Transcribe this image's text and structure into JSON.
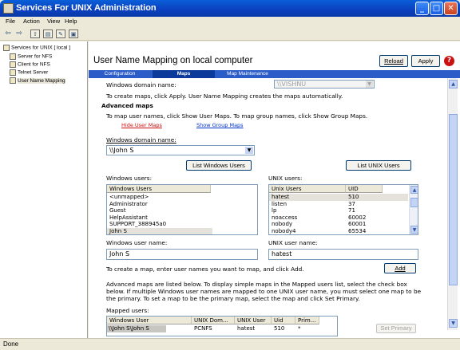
{
  "window": {
    "title": "Services For UNIX Administration"
  },
  "menu": [
    "File",
    "Action",
    "View",
    "Help"
  ],
  "toolbar_icons": [
    "back-arrow-icon",
    "forward-arrow-icon",
    "up-folder-icon",
    "show-tree-icon",
    "properties-icon",
    "help-icon"
  ],
  "tree": {
    "root": "Services for UNIX [ local ]",
    "items": [
      "Server for NFS",
      "Client for NFS",
      "Telnet Server",
      "User Name Mapping"
    ]
  },
  "page": {
    "title": "User Name Mapping on local computer",
    "reload_label": "Reload",
    "apply_label": "Apply",
    "tabs": [
      "Configuration",
      "Maps",
      "Map Maintenance"
    ]
  },
  "maps": {
    "domain_label_top": "Windows domain name:",
    "domain_value_top": "\\\\VISHNU",
    "create_hint": "To create maps, click Apply. User Name Mapping creates the maps automatically.",
    "advanced_heading": "Advanced maps",
    "advanced_hint": "To map user names, click Show User Maps. To map group names, click Show Group Maps.",
    "hide_user_maps": "Hide User Maps",
    "show_group_maps": "Show Group Maps",
    "windows_domain_label": "Windows domain name:",
    "windows_domain_value": "\\\\John S",
    "list_windows_users": "List Windows Users",
    "list_unix_users": "List UNIX Users",
    "windows_users_label": "Windows users:",
    "unix_users_label": "UNIX users:",
    "windows_users_header": "Windows Users",
    "windows_users": [
      "<unmapped>",
      "Administrator",
      "Guest",
      "HelpAssistant",
      "SUPPORT_388945a0",
      "John S"
    ],
    "unix_users_headers": [
      "Unix Users",
      "UID"
    ],
    "unix_users": [
      {
        "name": "hatest",
        "uid": "510"
      },
      {
        "name": "listen",
        "uid": "37"
      },
      {
        "name": "lp",
        "uid": "71"
      },
      {
        "name": "noaccess",
        "uid": "60002"
      },
      {
        "name": "nobody",
        "uid": "60001"
      },
      {
        "name": "nobody4",
        "uid": "65534"
      }
    ],
    "windows_user_name_label": "Windows user name:",
    "windows_user_name_value": "John S",
    "unix_user_name_label": "UNIX user name:",
    "unix_user_name_value": "hatest",
    "add_hint": "To create a map, enter user names you want to map, and click Add.",
    "add_label": "Add",
    "advanced_desc_1": "Advanced maps are listed below. To display simple maps in the Mapped users list, select the check box",
    "advanced_desc_2": "below. If multiple Windows user names are mapped to one UNIX user name, you must select one map to be",
    "advanced_desc_3": "the primary. To set a map to be the primary map, select the map and click Set Primary.",
    "mapped_users_label": "Mapped users:",
    "mapped_headers": [
      "Windows User",
      "UNIX Dom...",
      "UNIX User",
      "Uid",
      "Prim..."
    ],
    "mapped_rows": [
      {
        "windows_user": "\\\\John S\\John S",
        "unix_domain": "PCNFS",
        "unix_user": "hatest",
        "uid": "510",
        "primary": "*"
      }
    ],
    "set_primary_label": "Set Primary"
  },
  "status": {
    "text": "Done"
  },
  "colors": {
    "titlebar": "#0a3fbe",
    "tabs_bar": "#2c5cc8",
    "help_red": "#cc1010",
    "link_blue": "#0033cc"
  }
}
